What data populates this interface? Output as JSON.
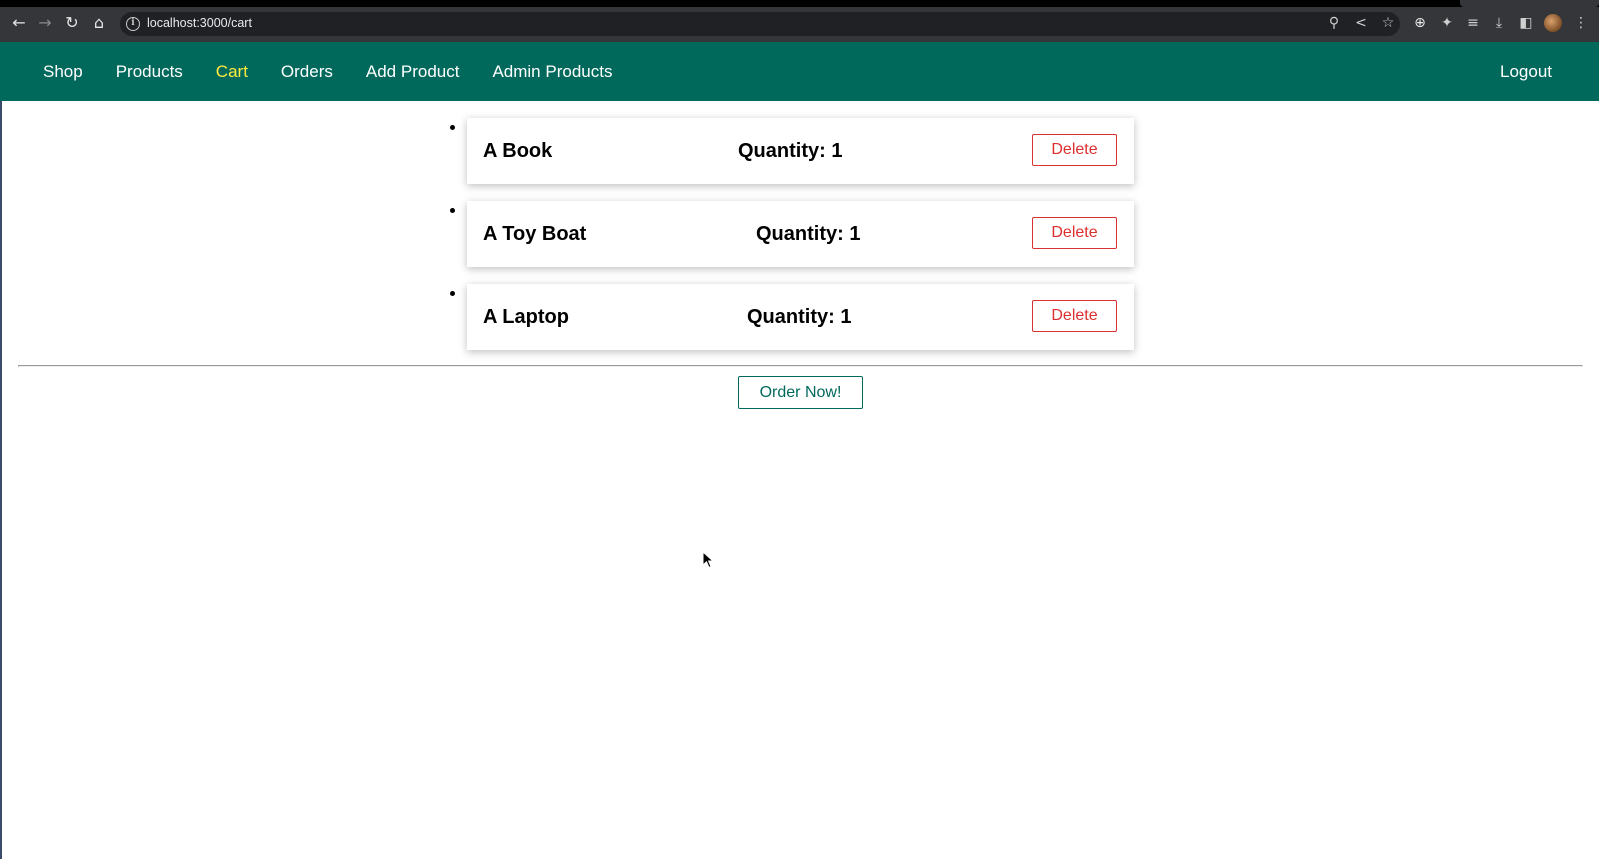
{
  "browser": {
    "url": "localhost:3000/cart",
    "icons": [
      "back-icon",
      "forward-icon",
      "reload-icon",
      "home-icon",
      "info-icon",
      "zoom-icon",
      "share-icon",
      "star-icon",
      "extension-icon",
      "puzzle-icon",
      "reading-list-icon",
      "download-icon",
      "sidebar-icon",
      "menu-icon"
    ]
  },
  "nav": {
    "items": [
      {
        "label": "Shop",
        "active": false
      },
      {
        "label": "Products",
        "active": false
      },
      {
        "label": "Cart",
        "active": true
      },
      {
        "label": "Orders",
        "active": false
      },
      {
        "label": "Add Product",
        "active": false
      },
      {
        "label": "Admin Products",
        "active": false
      }
    ],
    "logout": "Logout",
    "active_color": "#ffeb3b",
    "bg_color": "#00695c"
  },
  "cart": {
    "items": [
      {
        "title": "A Book",
        "quantity": "Quantity: 1",
        "delete_label": "Delete"
      },
      {
        "title": "A Toy Boat",
        "quantity": "Quantity: 1",
        "delete_label": "Delete"
      },
      {
        "title": "A Laptop",
        "quantity": "Quantity: 1",
        "delete_label": "Delete"
      }
    ],
    "order_label": "Order Now!",
    "delete_color": "#dc2f2f"
  }
}
